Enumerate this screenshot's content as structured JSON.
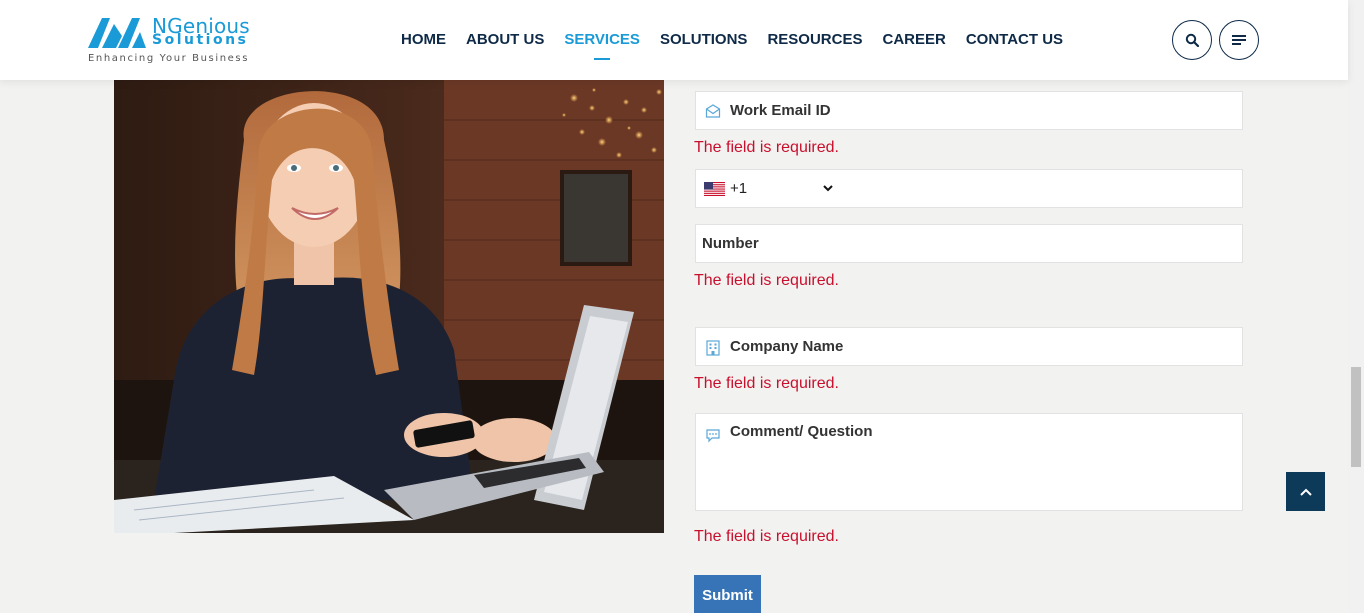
{
  "header": {
    "logo": {
      "name": "NGenious",
      "sub": "Solutions",
      "tagline": "Enhancing Your Business"
    },
    "nav": [
      {
        "label": "HOME",
        "active": false
      },
      {
        "label": "ABOUT US",
        "active": false
      },
      {
        "label": "SERVICES",
        "active": true
      },
      {
        "label": "SOLUTIONS",
        "active": false
      },
      {
        "label": "RESOURCES",
        "active": false
      },
      {
        "label": "CAREER",
        "active": false
      },
      {
        "label": "CONTACT US",
        "active": false
      }
    ],
    "search_icon": "search-icon",
    "menu_icon": "hamburger-menu-icon"
  },
  "form": {
    "email_placeholder": "Work Email ID",
    "email_error": "The field is required.",
    "country_code": "+1",
    "country_flag": "us-flag-icon",
    "number_placeholder": "Number",
    "number_error": "The field is required.",
    "company_placeholder": "Company Name",
    "company_error": "The field is required.",
    "comment_placeholder": "Comment/ Question",
    "comment_error": "The field is required.",
    "submit_label": "Submit"
  },
  "colors": {
    "accent": "#1a9bd7",
    "nav_text": "#0e2a47",
    "error": "#c8102e",
    "submit_bg": "#3773b7",
    "back_to_top_bg": "#0e3a5a"
  }
}
